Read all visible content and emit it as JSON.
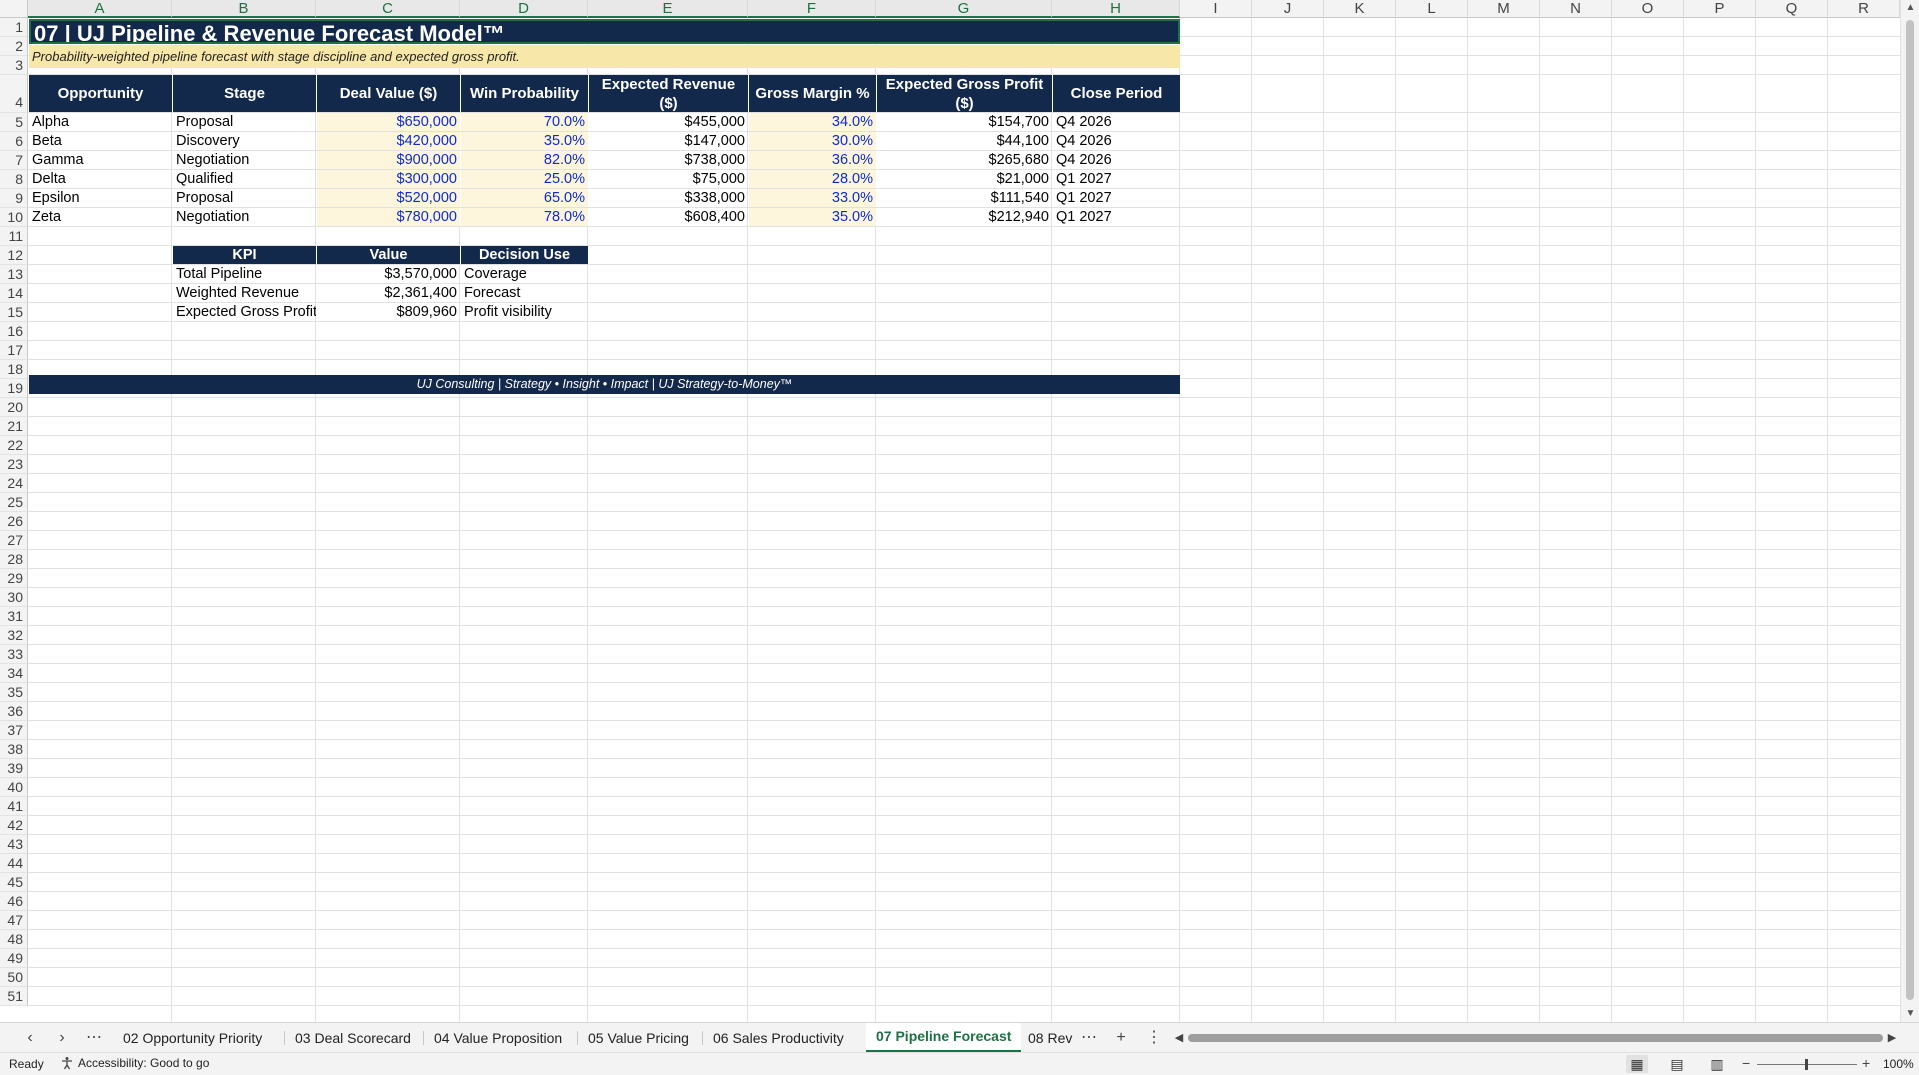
{
  "columns": [
    "A",
    "B",
    "C",
    "D",
    "E",
    "F",
    "G",
    "H",
    "I",
    "J",
    "K",
    "L",
    "M",
    "N",
    "O",
    "P",
    "Q",
    "R"
  ],
  "rows": [
    "1",
    "2",
    "3",
    "4",
    "5",
    "6",
    "7",
    "8",
    "9",
    "10",
    "11",
    "12",
    "13",
    "14",
    "15",
    "16",
    "17",
    "18",
    "19",
    "20",
    "21",
    "22",
    "23",
    "24",
    "25",
    "26",
    "27",
    "28",
    "29",
    "30",
    "31",
    "32",
    "33",
    "34",
    "35",
    "36",
    "37",
    "38",
    "39",
    "40",
    "41",
    "42",
    "43",
    "44",
    "45",
    "46",
    "47",
    "48",
    "49",
    "50",
    "51"
  ],
  "sheet": {
    "title": "07 | UJ Pipeline & Revenue Forecast Model™",
    "subtitle": "Probability-weighted pipeline forecast with stage discipline and expected gross profit.",
    "table_headers": [
      "Opportunity",
      "Stage",
      "Deal Value ($)",
      "Win Probability",
      "Expected Revenue ($)",
      "Gross Margin %",
      "Expected Gross Profit ($)",
      "Close Period"
    ],
    "table_rows": [
      [
        "Alpha",
        "Proposal",
        "$650,000",
        "70.0%",
        "$455,000",
        "34.0%",
        "$154,700",
        "Q4 2026"
      ],
      [
        "Beta",
        "Discovery",
        "$420,000",
        "35.0%",
        "$147,000",
        "30.0%",
        "$44,100",
        "Q4 2026"
      ],
      [
        "Gamma",
        "Negotiation",
        "$900,000",
        "82.0%",
        "$738,000",
        "36.0%",
        "$265,680",
        "Q4 2026"
      ],
      [
        "Delta",
        "Qualified",
        "$300,000",
        "25.0%",
        "$75,000",
        "28.0%",
        "$21,000",
        "Q1 2027"
      ],
      [
        "Epsilon",
        "Proposal",
        "$520,000",
        "65.0%",
        "$338,000",
        "33.0%",
        "$111,540",
        "Q1 2027"
      ],
      [
        "Zeta",
        "Negotiation",
        "$780,000",
        "78.0%",
        "$608,400",
        "35.0%",
        "$212,940",
        "Q1 2027"
      ]
    ],
    "kpi_headers": [
      "KPI",
      "Value",
      "Decision Use"
    ],
    "kpi_rows": [
      [
        "Total Pipeline",
        "$3,570,000",
        "Coverage"
      ],
      [
        "Weighted Revenue",
        "$2,361,400",
        "Forecast"
      ],
      [
        "Expected Gross Profit",
        "$809,960",
        "Profit visibility"
      ]
    ],
    "footer": "UJ Consulting | Strategy • Insight • Impact | UJ Strategy-to-Money™"
  },
  "tabs": {
    "items": [
      "02 Opportunity Priority",
      "03 Deal Scorecard",
      "04 Value Proposition",
      "05 Value Pricing",
      "06 Sales Productivity",
      "07 Pipeline Forecast",
      "08 Rev"
    ],
    "active_index": 5
  },
  "status": {
    "ready": "Ready",
    "accessibility": "Accessibility: Good to go",
    "zoom": "100%"
  },
  "colors": {
    "header_navy": "#13294b",
    "input_blue": "#0b2bd4",
    "input_fill": "#fdf6dc",
    "subtitle_fill": "#f7e7a9",
    "excel_green": "#1e7145"
  }
}
